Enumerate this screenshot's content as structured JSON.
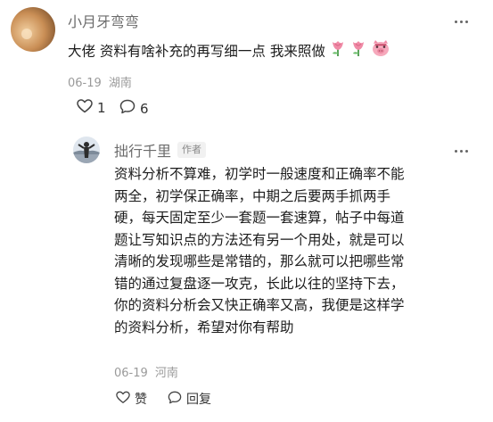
{
  "comment": {
    "author": "小月牙弯弯",
    "text": "大佬 资料有啥补充的再写细一点 我来照做",
    "emojis": [
      "tulip-emoji",
      "tulip-emoji",
      "pig-emoji"
    ],
    "date": "06-19",
    "location": "湖南",
    "like_count": "1",
    "reply_count": "6"
  },
  "reply": {
    "author": "拙行千里",
    "author_badge": "作者",
    "lines": [
      "资料分析不算难，初学时一般速度和正确率不能",
      "两全，初学保正确率，中期之后要两手抓两手",
      "硬，每天固定至少一套题一套速算，帖子中每道",
      "题让写知识点的方法还有另一个用处，就是可以",
      "清晰的发现哪些是常错的，那么就可以把哪些常",
      "错的通过复盘逐一攻克，长此以往的坚持下去，",
      "你的资料分析会又快正确率又高，我便是这样学",
      "的资料分析，希望对你有帮助"
    ],
    "date": "06-19",
    "location": "河南",
    "like_label": "赞",
    "reply_label": "回复"
  }
}
